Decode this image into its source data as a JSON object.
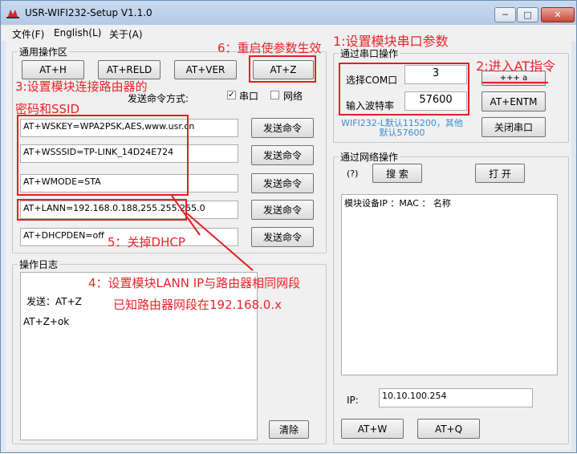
{
  "window": {
    "title": "USR-WIFI232-Setup V1.1.0",
    "min": "─",
    "max": "□",
    "close": "✕"
  },
  "menu": [
    "文件(F)",
    "English(L)",
    "关于(A)"
  ],
  "common": {
    "group": "通用操作区",
    "buttons": [
      "AT+H",
      "AT+RELD",
      "AT+VER",
      "AT+Z"
    ],
    "send_mode_label": "发送命令方式:",
    "serial_check": "✓",
    "serial_label": "串口",
    "network_label": "网络",
    "commands": [
      "AT+WSKEY=WPA2PSK,AES,www.usr.cn",
      "AT+WSSSID=TP-LINK_14D24E724",
      "AT+WMODE=STA",
      "AT+LANN=192.168.0.188,255.255.255.0",
      "AT+DHCPDEN=off"
    ],
    "send_button": "发送命令"
  },
  "log": {
    "group": "操作日志",
    "line1": "发送：AT+Z",
    "line2": "AT+Z+ok",
    "clear": "清除"
  },
  "serial": {
    "group": "通过串口操作",
    "com_label": "选择COM口",
    "com_value": "3",
    "baud_label": "输入波特率",
    "baud_value": "57600",
    "plus_btn": "+++ a",
    "entm_btn": "AT+ENTM",
    "close_btn": "关闭串口",
    "note": "WIFI232-L默认115200，其他默认57600"
  },
  "network": {
    "group": "通过网络操作",
    "help": "(?)",
    "search": "搜 索",
    "open": "打 开",
    "list_header": "模块设备IP  ：MAC ： 名称",
    "ip_label": "IP:",
    "ip_value": "10.10.100.254",
    "atw": "AT+W",
    "atq": "AT+Q"
  },
  "annotations": {
    "a1": "1:设置模块串口参数",
    "a2": "2:进入AT指令",
    "a3": "3:设置模块连接路由器的",
    "a3b": "密码和SSID",
    "a4": "4：设置模块LANN IP与路由器相同网段",
    "a4b": "已知路由器网段在192.168.0.x",
    "a5": "5：关掉DHCP",
    "a6": "6：重启使参数生效"
  }
}
